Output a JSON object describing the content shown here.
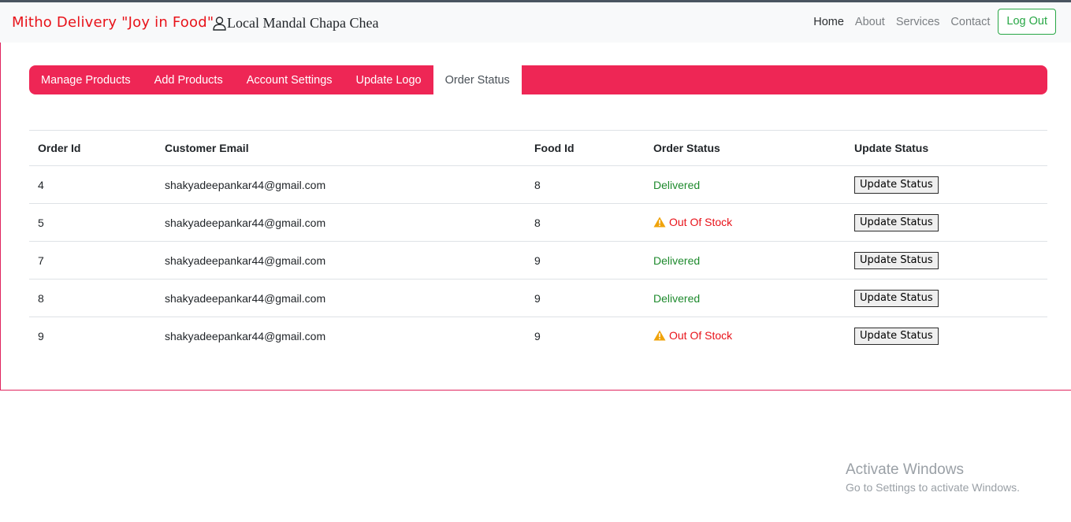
{
  "navbar": {
    "brand": "Mitho Delivery \"Joy in Food\"",
    "user_name": "Local Mandal Chapa Chea",
    "user_icon": "person-icon",
    "links": [
      {
        "label": "Home",
        "active": true
      },
      {
        "label": "About",
        "active": false
      },
      {
        "label": "Services",
        "active": false
      },
      {
        "label": "Contact",
        "active": false
      }
    ],
    "logout_label": "Log Out"
  },
  "tabs": [
    {
      "label": "Manage Products",
      "active": false
    },
    {
      "label": "Add Products",
      "active": false
    },
    {
      "label": "Account Settings",
      "active": false
    },
    {
      "label": "Update Logo",
      "active": false
    },
    {
      "label": "Order Status",
      "active": true
    }
  ],
  "table": {
    "headers": [
      "Order Id",
      "Customer Email",
      "Food Id",
      "Order Status",
      "Update Status"
    ],
    "rows": [
      {
        "order_id": "4",
        "email": "shakyadeepankar44@gmail.com",
        "food_id": "8",
        "status": "Delivered",
        "button": "Update Status"
      },
      {
        "order_id": "5",
        "email": "shakyadeepankar44@gmail.com",
        "food_id": "8",
        "status": "Out Of Stock",
        "button": "Update Status"
      },
      {
        "order_id": "7",
        "email": "shakyadeepankar44@gmail.com",
        "food_id": "9",
        "status": "Delivered",
        "button": "Update Status"
      },
      {
        "order_id": "8",
        "email": "shakyadeepankar44@gmail.com",
        "food_id": "9",
        "status": "Delivered",
        "button": "Update Status"
      },
      {
        "order_id": "9",
        "email": "shakyadeepankar44@gmail.com",
        "food_id": "9",
        "status": "Out Of Stock",
        "button": "Update Status"
      }
    ]
  },
  "colors": {
    "brand_red": "#e8131a",
    "tab_bar": "#ee2655",
    "delivered_green": "#1e8a2d",
    "warning_orange": "#f0a30a",
    "logout_green": "#28a745"
  },
  "watermark": {
    "title": "Activate Windows",
    "subtitle": "Go to Settings to activate Windows."
  }
}
